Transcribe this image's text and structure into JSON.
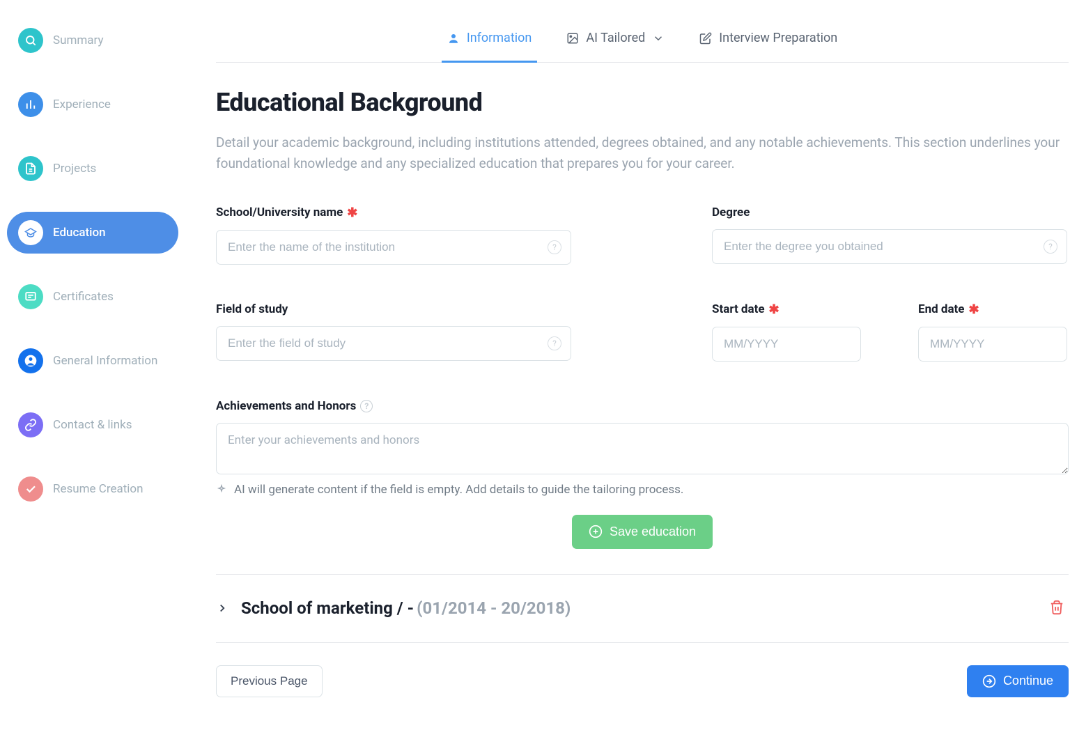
{
  "sidebar": {
    "items": [
      {
        "label": "Summary"
      },
      {
        "label": "Experience"
      },
      {
        "label": "Projects"
      },
      {
        "label": "Education"
      },
      {
        "label": "Certificates"
      },
      {
        "label": "General Information"
      },
      {
        "label": "Contact & links"
      },
      {
        "label": "Resume Creation"
      }
    ]
  },
  "tabs": [
    {
      "label": "Information"
    },
    {
      "label": "AI Tailored"
    },
    {
      "label": "Interview Preparation"
    }
  ],
  "page": {
    "title": "Educational Background",
    "description": "Detail your academic background, including institutions attended, degrees obtained, and any notable achievements. This section underlines your foundational knowledge and any specialized education that prepares you for your career."
  },
  "form": {
    "school": {
      "label": "School/University name",
      "placeholder": "Enter the name of the institution"
    },
    "degree": {
      "label": "Degree",
      "placeholder": "Enter the degree you obtained"
    },
    "field": {
      "label": "Field of study",
      "placeholder": "Enter the field of study"
    },
    "start": {
      "label": "Start date",
      "placeholder": "MM/YYYY"
    },
    "end": {
      "label": "End date",
      "placeholder": "MM/YYYY"
    },
    "achievements": {
      "label": "Achievements and Honors",
      "placeholder": "Enter your achievements and honors"
    },
    "hint": "AI will generate content if the field is empty. Add details to guide the tailoring process.",
    "save": "Save education"
  },
  "entries": [
    {
      "title": "School of marketing / -",
      "dates": "(01/2014 - 20/2018)"
    }
  ],
  "footer": {
    "prev": "Previous Page",
    "continue": "Continue"
  }
}
